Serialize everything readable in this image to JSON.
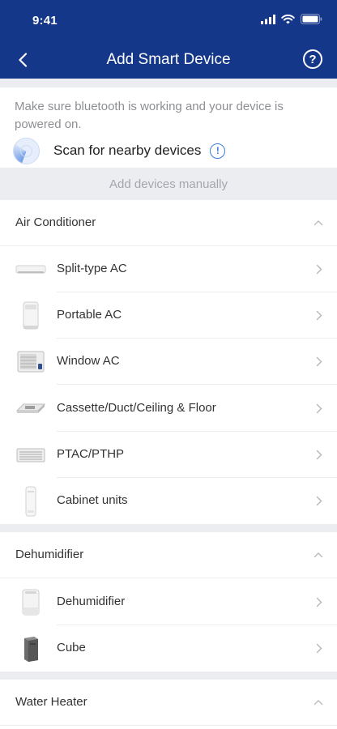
{
  "status_bar": {
    "time": "9:41",
    "icons": [
      "signal-icon",
      "wifi-icon",
      "battery-icon"
    ]
  },
  "nav": {
    "title": "Add Smart Device",
    "back_icon": "chevron-left-icon",
    "help_icon": "help-circle-icon",
    "help_symbol": "?"
  },
  "scan": {
    "message": "Make sure bluetooth is working and your device is powered on.",
    "label": "Scan for nearby devices",
    "info_symbol": "!"
  },
  "manual": {
    "label": "Add devices manually"
  },
  "sections": [
    {
      "title": "Air Conditioner",
      "expanded": true,
      "items": [
        {
          "label": "Split-type AC",
          "icon": "split-ac-icon"
        },
        {
          "label": "Portable AC",
          "icon": "portable-ac-icon"
        },
        {
          "label": "Window AC",
          "icon": "window-ac-icon"
        },
        {
          "label": "Cassette/Duct/Ceiling & Floor",
          "icon": "cassette-ac-icon"
        },
        {
          "label": "PTAC/PTHP",
          "icon": "ptac-icon"
        },
        {
          "label": "Cabinet units",
          "icon": "cabinet-unit-icon"
        }
      ]
    },
    {
      "title": "Dehumidifier",
      "expanded": true,
      "items": [
        {
          "label": "Dehumidifier",
          "icon": "dehumidifier-icon"
        },
        {
          "label": "Cube",
          "icon": "cube-dehumidifier-icon"
        }
      ]
    },
    {
      "title": "Water Heater",
      "expanded": true,
      "items": []
    }
  ],
  "colors": {
    "header": "#15378a",
    "accent": "#3a7ee3",
    "background_gray": "#ecedf1"
  }
}
